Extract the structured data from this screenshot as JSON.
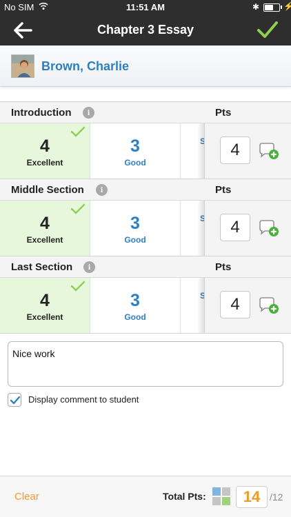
{
  "status_bar": {
    "carrier": "No SIM",
    "time": "11:51 AM"
  },
  "nav": {
    "title": "Chapter 3 Essay",
    "icons": {
      "back": "back-arrow-icon",
      "done": "checkmark-icon"
    }
  },
  "student": {
    "name": "Brown, Charlie"
  },
  "pts_header": "Pts",
  "criteria": [
    {
      "title": "Introduction",
      "levels": [
        {
          "score": "4",
          "label": "Excellent",
          "selected": true
        },
        {
          "score": "3",
          "label": "Good",
          "selected": false
        },
        {
          "score": "",
          "label": "S",
          "selected": false
        }
      ],
      "points": "4"
    },
    {
      "title": "Middle Section",
      "levels": [
        {
          "score": "4",
          "label": "Excellent",
          "selected": true
        },
        {
          "score": "3",
          "label": "Good",
          "selected": false
        },
        {
          "score": "",
          "label": "S",
          "selected": false
        }
      ],
      "points": "4"
    },
    {
      "title": "Last Section",
      "levels": [
        {
          "score": "4",
          "label": "Excellent",
          "selected": true
        },
        {
          "score": "3",
          "label": "Good",
          "selected": false
        },
        {
          "score": "",
          "label": "S",
          "selected": false
        }
      ],
      "points": "4"
    }
  ],
  "comment": {
    "text": "Nice work",
    "display_to_student_label": "Display comment to student",
    "display_to_student_checked": true
  },
  "footer": {
    "clear_label": "Clear",
    "total_label": "Total Pts:",
    "total_value": "14",
    "total_max": "/12"
  },
  "colors": {
    "accent_blue": "#2f7fc0",
    "accent_orange": "#ef9a2b",
    "selected_green": "#e6f7dc",
    "check_green": "#8fd14f",
    "bar_dark": "#2e2e2e"
  }
}
